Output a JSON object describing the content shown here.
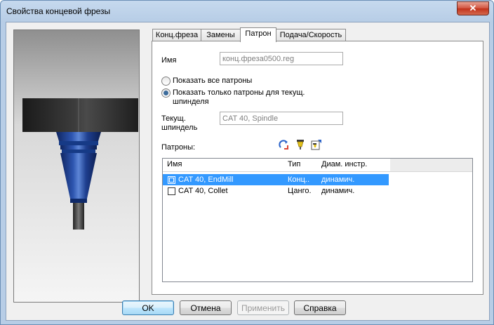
{
  "window": {
    "title": "Свойства концевой фрезы",
    "close_glyph": "✕"
  },
  "tabs": [
    {
      "label": "Конц.фреза"
    },
    {
      "label": "Замены"
    },
    {
      "label": "Патрон"
    },
    {
      "label": "Подача/Скорость"
    }
  ],
  "active_tab": "Патрон",
  "name_field": {
    "label": "Имя",
    "value": "конц.фреза0500.reg"
  },
  "radios": {
    "show_all": "Показать все патроны",
    "show_only_line1": "Показать только патроны для текущ.",
    "show_only_line2": "шпинделя",
    "selected": "show_only"
  },
  "spindle_field": {
    "label_line1": "Текущ.",
    "label_line2": "шпиндель",
    "value": "CAT 40, Spindle"
  },
  "holders_label": "Патроны:",
  "toolbar_icons": [
    "refresh-holders-icon",
    "holder-icon",
    "edit-holder-icon"
  ],
  "list": {
    "columns": [
      "Имя",
      "Тип",
      "Диам. инстр."
    ],
    "rows": [
      {
        "name": "CAT 40, EndMill",
        "type": "Конц..",
        "diam": "динамич.",
        "selected": true
      },
      {
        "name": "CAT 40, Collet",
        "type": "Цанго.",
        "diam": "динамич.",
        "selected": false
      }
    ]
  },
  "buttons": {
    "ok": "OK",
    "cancel": "Отмена",
    "apply": "Применить",
    "help": "Справка"
  },
  "colors": {
    "selection": "#3399ff",
    "holder_body": "#1f3f8f",
    "flange": "#2b2b2b"
  }
}
